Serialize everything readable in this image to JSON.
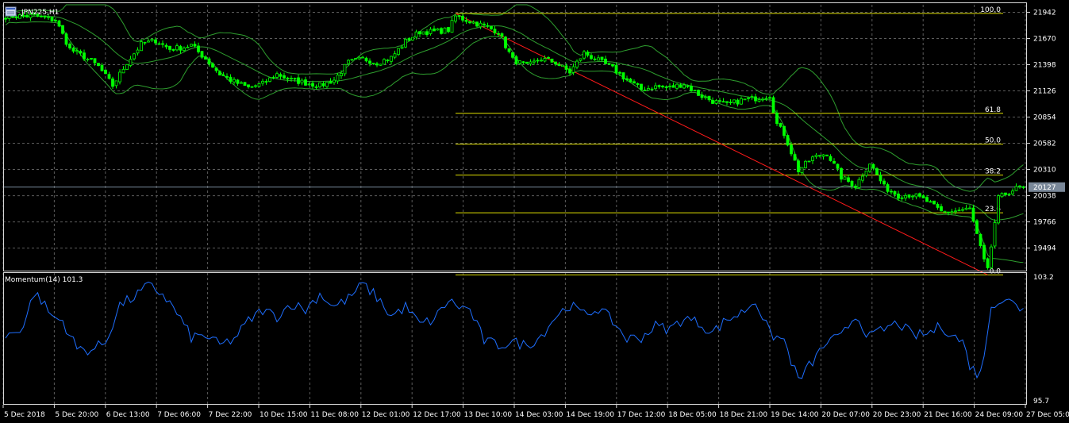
{
  "window": {
    "symbol_label": "JPN225,H1",
    "symbol_icon": "chart-window-icon"
  },
  "colors": {
    "background": "#000000",
    "grid": "#5c5c5c",
    "frame": "#d8d8d8",
    "candle": "#00ff00",
    "bands": "#2e9e2e",
    "fib": "#dede00",
    "fib_labels": "#ffff66",
    "trendline": "#ff1a1a",
    "momentum": "#1e6eff",
    "price_line": "#778899"
  },
  "chart_data": [
    {
      "type": "candlestick",
      "title": "JPN225,H1",
      "overlays": [
        "Bollinger Bands",
        "Fibonacci retracement",
        "Trendline"
      ],
      "y_ticks": [
        21942,
        21670,
        21398,
        21126,
        20854,
        20582,
        20310,
        20038,
        19766,
        19494
      ],
      "ylim": [
        19260,
        22020
      ],
      "current_price_label": "20127",
      "current_price": 20127,
      "fibonacci_levels": [
        {
          "label": "100.0",
          "price": 21930
        },
        {
          "label": "61.8",
          "price": 20893
        },
        {
          "label": "50.0",
          "price": 20573
        },
        {
          "label": "38.2",
          "price": 20252
        },
        {
          "label": "23.6",
          "price": 19860
        },
        {
          "label": "0.0",
          "price": 19216
        }
      ],
      "trendline": {
        "from": {
          "bar": 126,
          "price": 21930
        },
        "to": {
          "bar": 275,
          "price": 19216
        }
      },
      "close_keypoints": [
        [
          0,
          21900
        ],
        [
          8,
          21905
        ],
        [
          14,
          21860
        ],
        [
          18,
          21560
        ],
        [
          22,
          21480
        ],
        [
          26,
          21380
        ],
        [
          30,
          21180
        ],
        [
          34,
          21420
        ],
        [
          38,
          21610
        ],
        [
          42,
          21650
        ],
        [
          46,
          21560
        ],
        [
          50,
          21580
        ],
        [
          52,
          21600
        ],
        [
          56,
          21460
        ],
        [
          60,
          21300
        ],
        [
          64,
          21220
        ],
        [
          68,
          21160
        ],
        [
          72,
          21200
        ],
        [
          76,
          21300
        ],
        [
          80,
          21240
        ],
        [
          84,
          21210
        ],
        [
          88,
          21180
        ],
        [
          92,
          21240
        ],
        [
          96,
          21420
        ],
        [
          100,
          21460
        ],
        [
          104,
          21420
        ],
        [
          108,
          21470
        ],
        [
          112,
          21640
        ],
        [
          116,
          21740
        ],
        [
          120,
          21740
        ],
        [
          124,
          21760
        ],
        [
          126,
          21900
        ],
        [
          130,
          21850
        ],
        [
          134,
          21800
        ],
        [
          138,
          21740
        ],
        [
          142,
          21450
        ],
        [
          146,
          21380
        ],
        [
          150,
          21460
        ],
        [
          154,
          21420
        ],
        [
          158,
          21320
        ],
        [
          162,
          21520
        ],
        [
          166,
          21440
        ],
        [
          170,
          21360
        ],
        [
          174,
          21240
        ],
        [
          178,
          21140
        ],
        [
          182,
          21170
        ],
        [
          186,
          21160
        ],
        [
          190,
          21200
        ],
        [
          194,
          21090
        ],
        [
          198,
          21020
        ],
        [
          202,
          20980
        ],
        [
          206,
          21030
        ],
        [
          210,
          21050
        ],
        [
          214,
          21080
        ],
        [
          216,
          20780
        ],
        [
          218,
          20680
        ],
        [
          222,
          20300
        ],
        [
          226,
          20430
        ],
        [
          230,
          20480
        ],
        [
          234,
          20230
        ],
        [
          238,
          20140
        ],
        [
          242,
          20380
        ],
        [
          246,
          20130
        ],
        [
          250,
          20040
        ],
        [
          254,
          20050
        ],
        [
          258,
          19980
        ],
        [
          262,
          19870
        ],
        [
          266,
          19880
        ],
        [
          270,
          19900
        ],
        [
          272,
          19630
        ],
        [
          274,
          19360
        ],
        [
          275,
          19260
        ],
        [
          278,
          20010
        ],
        [
          281,
          20080
        ],
        [
          284,
          20127
        ]
      ]
    },
    {
      "type": "line",
      "title": "Momentum(14) 101.3",
      "series": [
        {
          "name": "Momentum(14)",
          "latest": 101.3
        }
      ],
      "y_ticks": [
        103.2,
        95.7
      ],
      "ylim": [
        95.7,
        103.2
      ],
      "keypoints": [
        [
          0,
          99.5
        ],
        [
          5,
          100.2
        ],
        [
          8,
          102.3
        ],
        [
          10,
          101.8
        ],
        [
          13,
          100.8
        ],
        [
          16,
          100.5
        ],
        [
          20,
          98.8
        ],
        [
          24,
          98.7
        ],
        [
          28,
          99.2
        ],
        [
          32,
          101.5
        ],
        [
          36,
          102.0
        ],
        [
          40,
          102.7
        ],
        [
          44,
          102.2
        ],
        [
          48,
          101.0
        ],
        [
          52,
          99.5
        ],
        [
          56,
          99.6
        ],
        [
          60,
          99.0
        ],
        [
          64,
          99.4
        ],
        [
          68,
          100.5
        ],
        [
          72,
          101.2
        ],
        [
          76,
          100.8
        ],
        [
          80,
          101.6
        ],
        [
          84,
          101.2
        ],
        [
          88,
          102.2
        ],
        [
          92,
          101.4
        ],
        [
          96,
          101.9
        ],
        [
          100,
          102.8
        ],
        [
          104,
          102.0
        ],
        [
          108,
          100.8
        ],
        [
          112,
          101.4
        ],
        [
          116,
          100.3
        ],
        [
          120,
          100.6
        ],
        [
          124,
          101.8
        ],
        [
          126,
          101.5
        ],
        [
          130,
          101.2
        ],
        [
          134,
          99.3
        ],
        [
          138,
          99.0
        ],
        [
          142,
          99.2
        ],
        [
          146,
          99.0
        ],
        [
          150,
          99.6
        ],
        [
          154,
          100.8
        ],
        [
          158,
          101.5
        ],
        [
          162,
          100.9
        ],
        [
          166,
          101.3
        ],
        [
          170,
          100.5
        ],
        [
          174,
          99.4
        ],
        [
          178,
          99.5
        ],
        [
          182,
          100.2
        ],
        [
          186,
          100.0
        ],
        [
          190,
          100.7
        ],
        [
          194,
          100.4
        ],
        [
          198,
          99.8
        ],
        [
          202,
          100.6
        ],
        [
          206,
          101.0
        ],
        [
          210,
          101.8
        ],
        [
          214,
          99.7
        ],
        [
          218,
          99.3
        ],
        [
          222,
          96.8
        ],
        [
          226,
          98.0
        ],
        [
          230,
          99.2
        ],
        [
          234,
          99.5
        ],
        [
          238,
          100.9
        ],
        [
          242,
          99.5
        ],
        [
          246,
          100.0
        ],
        [
          250,
          100.4
        ],
        [
          254,
          99.6
        ],
        [
          258,
          99.7
        ],
        [
          262,
          100.2
        ],
        [
          266,
          99.5
        ],
        [
          268,
          99.2
        ],
        [
          270,
          97.8
        ],
        [
          272,
          97.2
        ],
        [
          274,
          98.1
        ],
        [
          276,
          101.6
        ],
        [
          280,
          101.9
        ],
        [
          284,
          101.3
        ]
      ]
    }
  ],
  "x_axis_labels": [
    "5 Dec 2018",
    "5 Dec 20:00",
    "6 Dec 13:00",
    "7 Dec 06:00",
    "7 Dec 22:00",
    "10 Dec 15:00",
    "11 Dec 08:00",
    "12 Dec 01:00",
    "12 Dec 17:00",
    "13 Dec 10:00",
    "14 Dec 03:00",
    "14 Dec 19:00",
    "17 Dec 12:00",
    "18 Dec 05:00",
    "18 Dec 21:00",
    "19 Dec 14:00",
    "20 Dec 07:00",
    "20 Dec 23:00",
    "21 Dec 16:00",
    "24 Dec 09:00",
    "27 Dec 05:00"
  ]
}
